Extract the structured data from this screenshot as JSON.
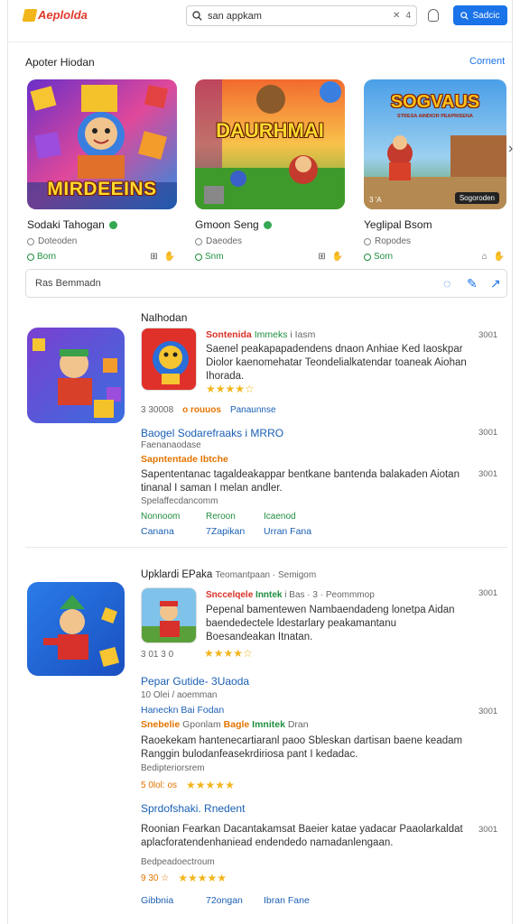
{
  "header": {
    "logo": "Aeplolda",
    "search_value": "san appkam",
    "search_end": "4",
    "signin_label": "Sadcic"
  },
  "section1": {
    "title": "Apoter Hiodan",
    "link": "Cornent",
    "cards": [
      {
        "art_text": "MIRDEEINS",
        "title": "Sodaki Tahogan",
        "sub": "Doteoden",
        "foot": "Born",
        "icons": "⊞ ✋"
      },
      {
        "art_text": "DAURHMAI",
        "title": "Gmoon Seng",
        "sub": "Daeodes",
        "foot": "Snm",
        "icons": "⊞ ✋"
      },
      {
        "art_text": "SOGVAUS",
        "art_sub": "STRESA AINDIOR PEAPRISENA",
        "art_badge": "Sogoroden",
        "art_corner": "3 'A",
        "title": "Yeglipal Bsom",
        "sub": "Ropodes",
        "foot": "Sorn",
        "icons": "⌂ ✋"
      }
    ],
    "filter_placeholder": "Ras Bemmadn"
  },
  "feed": {
    "heading1": "Nalhodan",
    "item1": {
      "head_red": "Sontenida",
      "head_green": "Immeks",
      "head_gray": "i Iasm",
      "time": "3001",
      "text": "Saenel peakapapadendens dnaon Anhiae Ked Iaoskpar Diolor kaenomehatar Teondelialkatendar toaneak Aiohan Ihorada.",
      "stars": "★★★★☆",
      "meta_left": "3 30008",
      "meta_orange": "o rouuos",
      "meta_blue": "Panaunnse",
      "link_line": "Baogel Sodarefraaks i MRRO",
      "link_time": "3001",
      "sub_gray": "Faenanaodase",
      "orange_line": "Sapntentade Ibtche",
      "para2": "Sapententanac tagaldeakappar bentkane bantenda balakaden Aiotan tinanal I saman I melan andler.",
      "para2_time": "3001",
      "para2_sub": "Spelaffecdancomm",
      "labels": [
        "Nonnoom",
        "Reroon",
        "Icaenod"
      ],
      "links": [
        "Canana",
        "7Zapikan",
        "Urran Fana"
      ]
    },
    "heading2": "Upklardi EPaka",
    "heading2_gray": "Teomantpaan · Semigom",
    "item2": {
      "head_red": "Snccelqele",
      "head_green": "Inntek",
      "head_gray": "i Bas · 3 · Peommmop",
      "time": "3001",
      "text": "Pepenal bamentewen Nambaendadeng lonetpa Aidan baendedectele ldestarlary peakamantanu Boesandeakan Itnatan.",
      "stars": "★★★★☆",
      "meta_left": "3 01 3 0",
      "link_line": "Pepar Gutide- 3Uaoda",
      "sub_gray": "10 Olei / aoemman",
      "blue_small": "Haneckn Bai Fodan",
      "blue_small_time": "3001",
      "multi_a": "Snebelie",
      "multi_b": "Gponlam",
      "multi_c": "Bagle",
      "multi_d": "Imnitek",
      "multi_e": "Dran",
      "para2": "Raoekekam hantenecartiaranl paoo Sbleskan dartisan baene keadam Ranggin bulodanfeasekrdiriosa pant I kedadac.",
      "para2_sub": "Bedipteriorsrem",
      "rating_left": "5 0lol: os",
      "stars2": "★★★★★",
      "section3": "Sprdofshaki. Rnedent",
      "para3": "Roonian Fearkan Dacantakamsat Baeier katae yadacar Paaolarkaldat aplacforatendenhaniead endendedo namadanlengaan.",
      "para3_time": "3001",
      "para3_sub": "Bedpeadoectroum",
      "rating3_left": "9 30 ☆",
      "stars3": "★★★★★",
      "links": [
        "Gibbnia",
        "72ongan",
        "Ibran Fane"
      ]
    }
  },
  "colors": {
    "accent": "#1a73e8",
    "brand_red": "#e03a2c",
    "star": "#f2b51b",
    "green": "#1e8e3e"
  }
}
